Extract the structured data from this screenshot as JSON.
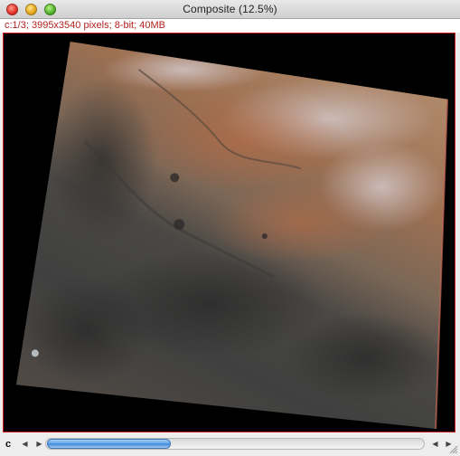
{
  "window": {
    "title": "Composite (12.5%)"
  },
  "info": {
    "text": "c:1/3; 3995x3540 pixels; 8-bit; 40MB"
  },
  "canvas": {
    "border_color": "#cc1f1f",
    "background": "#000000"
  },
  "bottom": {
    "channel_label": "c",
    "scroll_position": 0.0,
    "scroll_thumb_fraction": 0.33,
    "icons": [
      "left-arrow-icon",
      "right-arrow-icon",
      "scroll-left-icon",
      "scroll-right-icon"
    ]
  }
}
